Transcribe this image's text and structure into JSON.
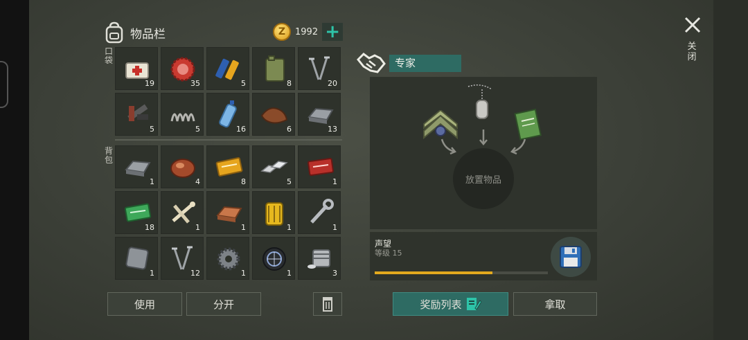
{
  "inventory": {
    "title": "物品栏",
    "coins": "1992",
    "pocket_label": "口袋",
    "backpack_label": "背包",
    "pocket_slots": [
      {
        "name": "first-aid-kit",
        "qty": "19"
      },
      {
        "name": "bottle-cap",
        "qty": "35"
      },
      {
        "name": "batteries",
        "qty": "5"
      },
      {
        "name": "fuel-canister",
        "qty": "8"
      },
      {
        "name": "nails",
        "qty": "20"
      },
      {
        "name": "scrap-pipes",
        "qty": "5"
      },
      {
        "name": "spring",
        "qty": "5"
      },
      {
        "name": "water-bottle",
        "qty": "16"
      },
      {
        "name": "leather",
        "qty": "6"
      },
      {
        "name": "iron-bar",
        "qty": "13"
      }
    ],
    "backpack_slots": [
      {
        "name": "iron-bar",
        "qty": "1"
      },
      {
        "name": "raw-meat",
        "qty": "4"
      },
      {
        "name": "survival-coupon",
        "qty": "8"
      },
      {
        "name": "aluminum-bars",
        "qty": "5"
      },
      {
        "name": "combat-coupon",
        "qty": "1"
      },
      {
        "name": "ration-coupon",
        "qty": "18"
      },
      {
        "name": "bones",
        "qty": "1"
      },
      {
        "name": "copper-bar",
        "qty": "1"
      },
      {
        "name": "oil-filter",
        "qty": "1"
      },
      {
        "name": "wrench",
        "qty": "1"
      },
      {
        "name": "metal-plate",
        "qty": "1"
      },
      {
        "name": "nails",
        "qty": "12"
      },
      {
        "name": "gear",
        "qty": "1"
      },
      {
        "name": "wheel",
        "qty": "1"
      },
      {
        "name": "engine-part",
        "qty": "3"
      }
    ],
    "use_label": "使用",
    "split_label": "分开"
  },
  "expert": {
    "label": "专家",
    "drop_text": "放置物品",
    "reputation_title": "声望",
    "reputation_level": "等级 15",
    "reputation_progress": 0.68,
    "rewards_label": "奖励列表",
    "take_label": "拿取"
  },
  "window": {
    "close_label": "关闭"
  },
  "colors": {
    "accent": "#2e6b63",
    "coin": "#e8b43a",
    "progress": "#e2a91e"
  }
}
